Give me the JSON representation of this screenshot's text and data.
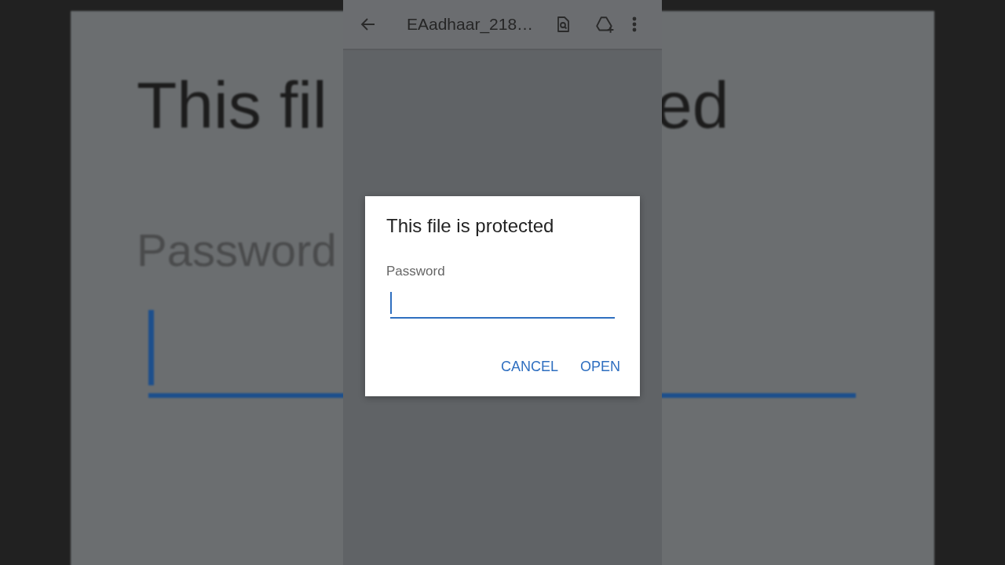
{
  "backdrop": {
    "title_left": "This fil",
    "title_right": "ed",
    "label": "Password"
  },
  "toolbar": {
    "title": "EAadhaar_218…"
  },
  "dialog": {
    "title": "This file is protected",
    "field": {
      "label": "Password",
      "focused": true
    },
    "buttons": [
      {
        "label": "CANCEL"
      },
      {
        "label": "OPEN"
      }
    ]
  }
}
